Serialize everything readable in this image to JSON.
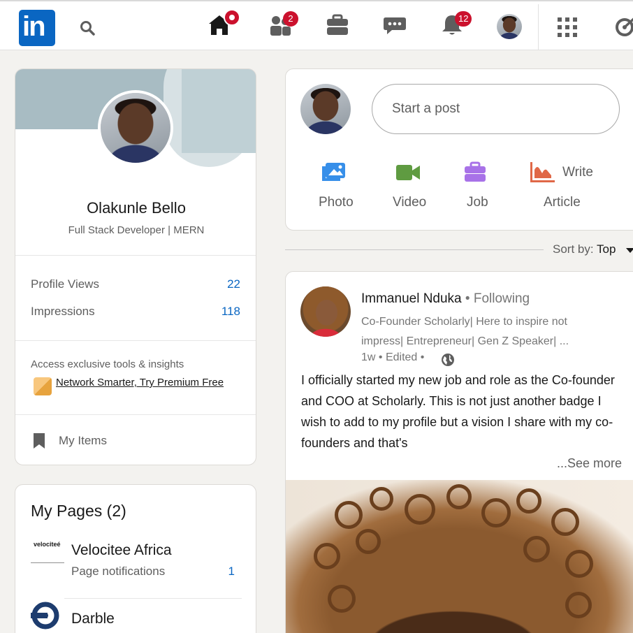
{
  "nav": {
    "logo_text": "in",
    "home_badge": "",
    "network_badge": "2",
    "notifications_badge": "12"
  },
  "profile": {
    "name": "Olakunle Bello",
    "headline": "Full Stack Developer | MERN",
    "stats": [
      {
        "label": "Profile Views",
        "value": "22"
      },
      {
        "label": "Impressions",
        "value": "118"
      }
    ],
    "premium_text": "Access exclusive tools & insights",
    "premium_link": "Network Smarter, Try Premium Free",
    "my_items": "My Items"
  },
  "pages": {
    "title": "My Pages (2)",
    "items": [
      {
        "logo_text": "velociteé",
        "name": "Velocitee Africa",
        "sub": "Page notifications",
        "count": "1"
      },
      {
        "name": "Darble"
      }
    ]
  },
  "postbox": {
    "placeholder": "Start a post",
    "actions": [
      {
        "label": "Photo",
        "icon": "photo-icon",
        "color": "#378fe9"
      },
      {
        "label": "Video",
        "icon": "video-icon",
        "color": "#5f9b41"
      },
      {
        "label": "Job",
        "icon": "briefcase-icon",
        "color": "#a872e8"
      },
      {
        "label": "Write",
        "label2": "Article",
        "icon": "article-icon",
        "color": "#e06847"
      }
    ]
  },
  "sort": {
    "label": "Sort by:",
    "value": "Top"
  },
  "post": {
    "author": "Immanuel Nduka",
    "follow": " • Following",
    "headline": "Co-Founder Scholarly| Here to inspire not impress| Entrepreneur| Gen Z Speaker| ...",
    "meta": "1w • Edited •",
    "body": "I officially started my new job and role as the Co-founder and COO at Scholarly. This is not just another badge I wish to add to my profile but a vision I share with my co-founders and that's",
    "see_more": "...See more"
  },
  "colors": {
    "brand": "#0a66c2",
    "badge": "#cb112d",
    "page_bg": "#f3f2ef"
  }
}
